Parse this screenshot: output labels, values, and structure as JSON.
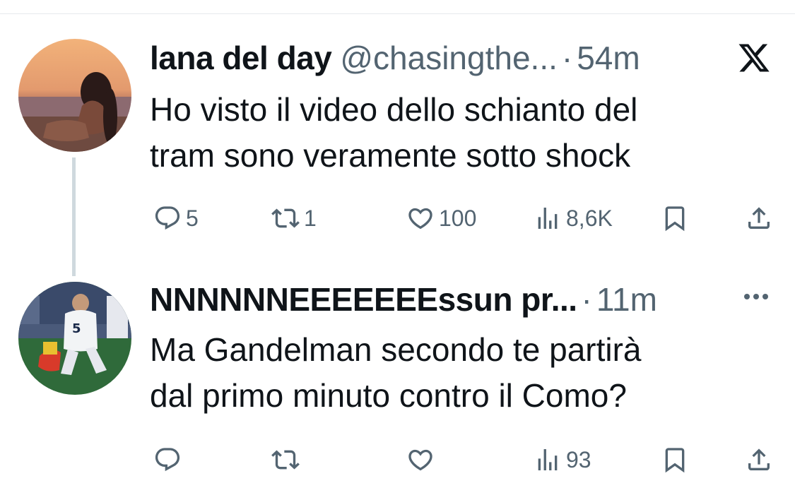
{
  "tweets": [
    {
      "display_name": "lana del day",
      "handle": "@chasingthe...",
      "separator": "·",
      "time": "54m",
      "text_lines": [
        "Ho visto il video dello schianto del",
        "tram sono veramente sotto shock"
      ],
      "actions": {
        "reply_count": "5",
        "retweet_count": "1",
        "like_count": "100",
        "views_count": "8,6K"
      },
      "header_icon": "x-logo-icon"
    },
    {
      "display_name": "NNNNNNEEEEEEEssun pr...",
      "separator": "·",
      "time": "11m",
      "text_lines": [
        "Ma Gandelman secondo te partirà",
        "dal primo minuto contro il Como?"
      ],
      "actions": {
        "reply_count": "",
        "retweet_count": "",
        "like_count": "",
        "views_count": "93"
      },
      "header_icon": "more-icon"
    }
  ],
  "colors": {
    "text_primary": "#0f1419",
    "text_secondary": "#536471",
    "thread_line": "#cfd9de",
    "divider": "#e6e9ec"
  }
}
